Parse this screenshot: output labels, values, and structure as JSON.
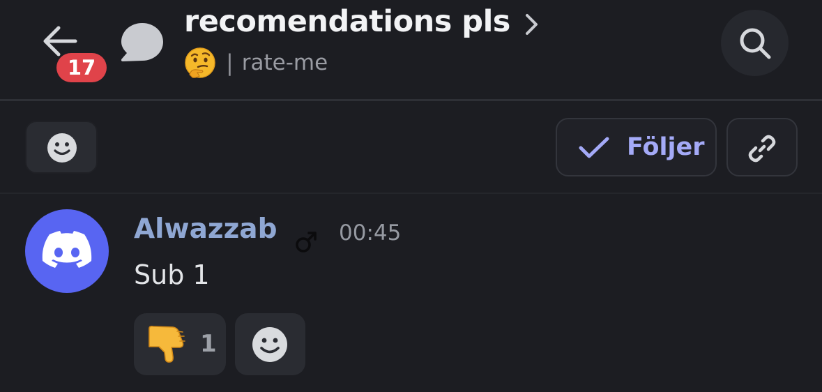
{
  "header": {
    "back_label": "Back",
    "unread_count": "17",
    "title": "recomendations pls",
    "subtitle_emoji": "thinking-face",
    "subtitle_separator": "|",
    "channel_name": "rate-me",
    "search_icon": "search-icon"
  },
  "toolbar": {
    "emoji_button_icon": "smiley-icon",
    "follow_label": "Följer",
    "follow_icon": "checkmark-icon",
    "link_icon": "link-icon"
  },
  "message": {
    "author": "Alwazzab",
    "author_badge": "male-sign-icon",
    "timestamp": "00:45",
    "text": "Sub 1",
    "reactions": [
      {
        "emoji": "thumbs-down",
        "count": "1"
      }
    ],
    "add_reaction_icon": "smiley-icon"
  },
  "colors": {
    "background": "#1c1d22",
    "badge": "#e0434a",
    "accent": "#a4aaf7",
    "author": "#8fa7d3",
    "avatar": "#5865f2"
  }
}
